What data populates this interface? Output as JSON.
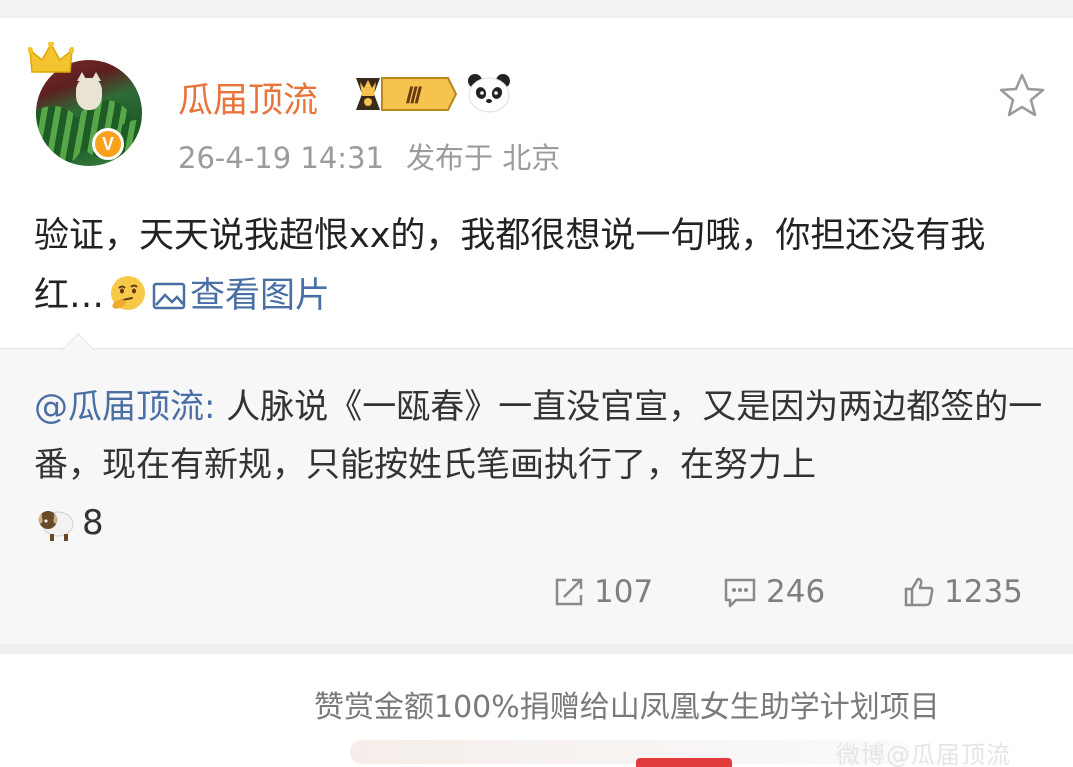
{
  "post": {
    "username": "瓜届顶流",
    "member_level": "Ⅲ",
    "timestamp": "26-4-19 14:31",
    "location": "发布于 北京",
    "verified_badge": "V",
    "content": "验证，天天说我超恨xx的，我都很想说一句哦，你担还没有我红…",
    "view_image_label": "查看图片",
    "icons": [
      "crown-icon",
      "vip-badge-icon",
      "panda-icon",
      "star-icon",
      "thinking-face-emoji",
      "image-icon"
    ]
  },
  "repost": {
    "mention": "@瓜届顶流:",
    "text": " 人脉说《一瓯春》一直没官宣，又是因为两边都签的一番，现在有新规，只能按姓氏笔画执行了，在努力上",
    "emoji_name": "sheep-emoji",
    "text_suffix": "8"
  },
  "actions": {
    "repost_count": "107",
    "comment_count": "246",
    "like_count": "1235"
  },
  "reward": {
    "text": "赞赏金额100%捐赠给山凤凰女生助学计划项目"
  },
  "watermark": "微博@瓜届顶流",
  "colors": {
    "username": "#e8743b",
    "link": "#4a6fa5",
    "meta": "#9b9b9b",
    "verified": "#f7a21a"
  }
}
